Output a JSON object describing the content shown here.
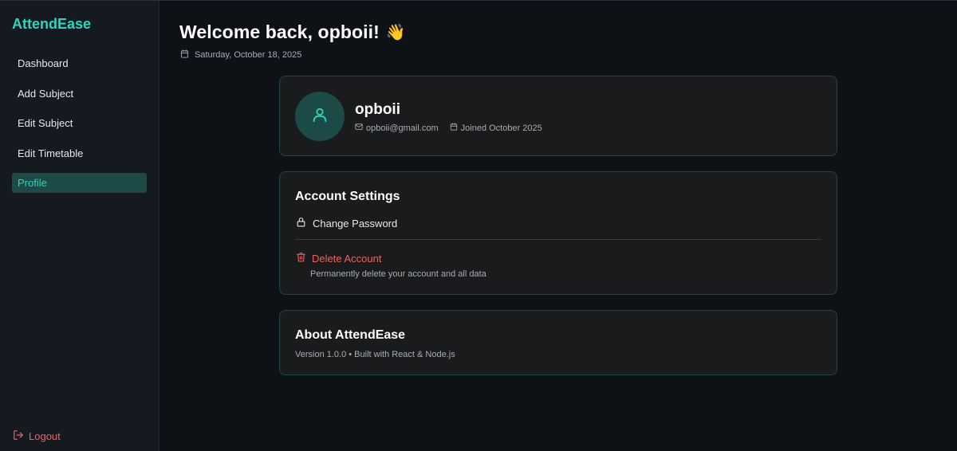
{
  "app": {
    "brand": "AttendEase",
    "accent": "#2dd4bf",
    "danger": "#f0625a"
  },
  "sidebar": {
    "items": [
      {
        "label": "Dashboard",
        "active": false
      },
      {
        "label": "Add Subject",
        "active": false
      },
      {
        "label": "Edit Subject",
        "active": false
      },
      {
        "label": "Edit Timetable",
        "active": false
      },
      {
        "label": "Profile",
        "active": true
      }
    ],
    "logout_label": "Logout",
    "logout_icon": "logout-icon"
  },
  "header": {
    "welcome": "Welcome back, opboii!",
    "wave_emoji": "👋",
    "date": "Saturday, October 18, 2025",
    "date_icon": "calendar-icon"
  },
  "profile": {
    "name": "opboii",
    "email": "opboii@gmail.com",
    "joined": "Joined October 2025",
    "avatar_icon": "user-icon"
  },
  "settings": {
    "title": "Account Settings",
    "change_password_label": "Change Password",
    "delete_label": "Delete Account",
    "delete_description": "Permanently delete your account and all data"
  },
  "about": {
    "title": "About AttendEase",
    "version_text": "Version 1.0.0 • Built with React & Node.js"
  }
}
